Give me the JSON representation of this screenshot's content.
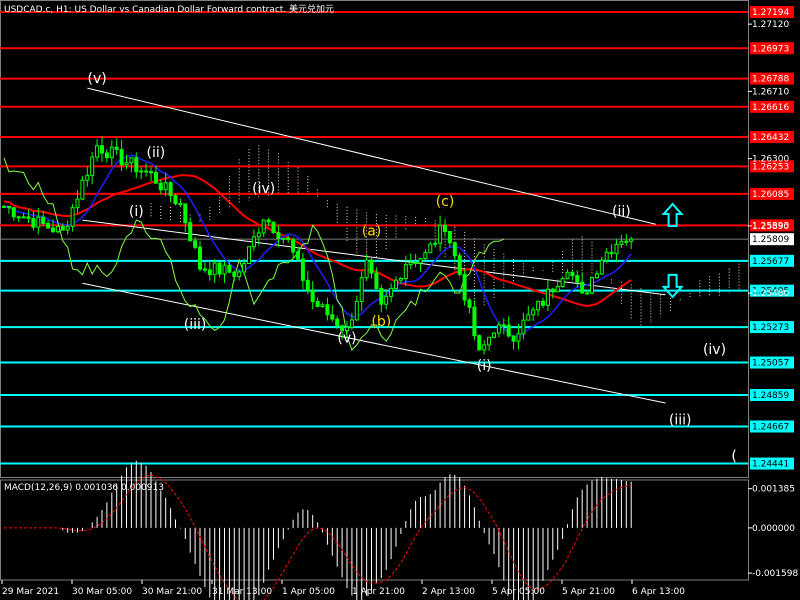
{
  "header": {
    "symbol_title": "USDCAD.c, H1:  US Dollar vs Canadian Dollar Forward contract. 美元兑加元"
  },
  "macd": {
    "label": "MACD(12,26,9) 0.001036 0.000913",
    "tick_labels": [
      "0.001385",
      "0.000000",
      "-0.001598"
    ],
    "ticks": [
      0.001385,
      0.0,
      -0.001598
    ],
    "range": [
      -0.0017,
      0.00155
    ],
    "histogram_positive_color": "#ffffff",
    "signal_color": "#ff0000"
  },
  "colors": {
    "background": "#000000",
    "candle": "#00ff00",
    "resistance_line": "#ff0000",
    "resistance_box": "#ff0000",
    "support_line": "#00ffff",
    "support_box_text": "#000000",
    "current_price_box": "#ffffff",
    "ma_red": "#ff0000",
    "ma_blue": "#2020ff",
    "chikou": "#80ff40",
    "cloud": "#ffe0c0",
    "trendline": "#ffffff",
    "wave_white": "#ffffff",
    "wave_yellow": "#ffd700",
    "arrow": "#00ffff"
  },
  "chart_data": {
    "type": "candlestick",
    "title": "USDCAD.c, H1:  US Dollar vs Canadian Dollar Forward contract. 美元兑加元",
    "ylim": [
      1.24359,
      1.27255
    ],
    "grid": false,
    "x_tick_labels": [
      "29 Mar 2021",
      "30 Mar 05:00",
      "30 Mar 21:00",
      "31 Mar 13:00",
      "1 Apr 05:00",
      "1 Apr 21:00",
      "2 Apr 13:00",
      "5 Apr 05:00",
      "5 Apr 21:00",
      "6 Apr 13:00"
    ],
    "y_tick_labels": [
      "1.27120",
      "1.26710",
      "1.26300",
      "1.25890",
      "1.25480"
    ],
    "y_ticks": [
      1.2712,
      1.2671,
      1.263,
      1.2589,
      1.2548
    ],
    "current_price": {
      "label": "1.25809",
      "value": 1.25809
    },
    "resistance_levels": [
      {
        "label": "1.27194",
        "value": 1.27194
      },
      {
        "label": "1.26973",
        "value": 1.26973
      },
      {
        "label": "1.26788",
        "value": 1.26788
      },
      {
        "label": "1.26616",
        "value": 1.26616
      },
      {
        "label": "1.26432",
        "value": 1.26432
      },
      {
        "label": "1.26253",
        "value": 1.26253
      },
      {
        "label": "1.26085",
        "value": 1.26085
      },
      {
        "label": "1.25893",
        "value": 1.25893
      }
    ],
    "support_levels": [
      {
        "label": "1.25677",
        "value": 1.25677
      },
      {
        "label": "1.25495",
        "value": 1.25495
      },
      {
        "label": "1.25273",
        "value": 1.25273
      },
      {
        "label": "1.25057",
        "value": 1.25057
      },
      {
        "label": "1.24859",
        "value": 1.24859
      },
      {
        "label": "1.24667",
        "value": 1.24667
      },
      {
        "label": "1.24441",
        "value": 1.24441
      }
    ],
    "wave_labels": [
      {
        "text": "(v)",
        "bar": 19,
        "price": 1.2676,
        "color": "white"
      },
      {
        "text": "(ii)",
        "bar": 31,
        "price": 1.2631,
        "color": "white"
      },
      {
        "text": "(iv)",
        "bar": 53,
        "price": 1.2609,
        "color": "white"
      },
      {
        "text": "(i)",
        "bar": 27,
        "price": 1.2595,
        "color": "white"
      },
      {
        "text": "(iii)",
        "bar": 39,
        "price": 1.2526,
        "color": "white"
      },
      {
        "text": "(v)",
        "bar": 70,
        "price": 1.2518,
        "color": "white"
      },
      {
        "text": "(a)",
        "bar": 75,
        "price": 1.2583,
        "color": "yellow"
      },
      {
        "text": "(b)",
        "bar": 77,
        "price": 1.2528,
        "color": "yellow"
      },
      {
        "text": "(c)",
        "bar": 90,
        "price": 1.2601,
        "color": "yellow"
      },
      {
        "text": "(ii)",
        "bar": 126,
        "price": 1.2595,
        "color": "white"
      },
      {
        "text": "(i)",
        "bar": 98,
        "price": 1.2501,
        "color": "white"
      },
      {
        "text": "(iv)",
        "bar": 145,
        "price": 1.2511,
        "color": "white"
      },
      {
        "text": "(iii)",
        "bar": 138,
        "price": 1.2468,
        "color": "white"
      },
      {
        "text": "(",
        "bar": 149,
        "price": 1.2446,
        "color": "white"
      }
    ],
    "trendlines": [
      {
        "from": {
          "bar": 17,
          "price": 1.2673
        },
        "to": {
          "bar": 133,
          "price": 1.259
        }
      },
      {
        "from": {
          "bar": 16,
          "price": 1.25925
        },
        "to": {
          "bar": 135,
          "price": 1.2547
        }
      },
      {
        "from": {
          "bar": 16,
          "price": 1.2554
        },
        "to": {
          "bar": 135,
          "price": 1.2481
        }
      }
    ],
    "arrows": [
      {
        "direction": "up",
        "bar": 134,
        "price": 1.2595
      },
      {
        "direction": "down",
        "bar": 134,
        "price": 1.2553
      }
    ],
    "key_points": [
      {
        "bar": 0,
        "price": 1.2601
      },
      {
        "bar": 6,
        "price": 1.2592
      },
      {
        "bar": 12,
        "price": 1.2585
      },
      {
        "bar": 19,
        "price": 1.2638
      },
      {
        "bar": 25,
        "price": 1.2628
      },
      {
        "bar": 30,
        "price": 1.262
      },
      {
        "bar": 36,
        "price": 1.2602
      },
      {
        "bar": 40,
        "price": 1.2564
      },
      {
        "bar": 48,
        "price": 1.256
      },
      {
        "bar": 53,
        "price": 1.2595
      },
      {
        "bar": 58,
        "price": 1.2579
      },
      {
        "bar": 63,
        "price": 1.2543
      },
      {
        "bar": 70,
        "price": 1.2525
      },
      {
        "bar": 74,
        "price": 1.2565
      },
      {
        "bar": 77,
        "price": 1.2538
      },
      {
        "bar": 82,
        "price": 1.2567
      },
      {
        "bar": 86,
        "price": 1.2571
      },
      {
        "bar": 90,
        "price": 1.259
      },
      {
        "bar": 93,
        "price": 1.256
      },
      {
        "bar": 97,
        "price": 1.251
      },
      {
        "bar": 100,
        "price": 1.2527
      },
      {
        "bar": 104,
        "price": 1.2523
      },
      {
        "bar": 110,
        "price": 1.2543
      },
      {
        "bar": 115,
        "price": 1.2565
      },
      {
        "bar": 118,
        "price": 1.2545
      },
      {
        "bar": 122,
        "price": 1.257
      },
      {
        "bar": 126,
        "price": 1.2582
      },
      {
        "bar": 128,
        "price": 1.25809
      }
    ],
    "bar_count": 150
  }
}
